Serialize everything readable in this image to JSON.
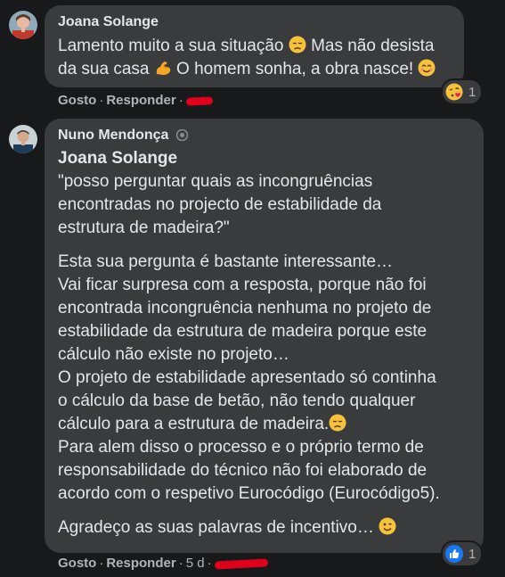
{
  "comment1": {
    "author": "Joana Solange",
    "line1": "Lamento muito a sua situação",
    "line1b": "Mas não desista",
    "line2a": "da sua casa",
    "line2b": "O homem sonha, a obra nasce!",
    "like": "Gosto",
    "reply": "Responder",
    "reaction_count": "1",
    "emojis": [
      "disappointed-face",
      "flexed-biceps",
      "smiling-face",
      "face-blowing-kiss"
    ]
  },
  "comment2": {
    "author": "Nuno Mendonça",
    "mention": "Joana Solange",
    "lines": [
      "\"posso perguntar quais as incongruências",
      "encontradas no projecto de estabilidade da",
      "estrutura de madeira?\""
    ],
    "lines2": [
      "Esta sua pergunta é bastante interessante…",
      "Vai ficar surpresa com a resposta, porque não foi",
      "encontrada incongruência nenhuma no projeto de",
      "estabilidade da estrutura de madeira porque este",
      "cálculo não existe no projeto…",
      "O projeto de estabilidade apresentado só continha",
      "o cálculo da base de betão, não tendo qualquer",
      "cálculo para a estrutura de madeira.",
      "Para alem disso o processo e o próprio termo de",
      "responsabilidade do técnico não foi elaborado de",
      "acordo com o respetivo Eurocódigo (Eurocódigo5)."
    ],
    "closing": "Agradeço as suas palavras de incentivo…",
    "like": "Gosto",
    "reply": "Responder",
    "time": "5 d",
    "reaction_count": "1",
    "emojis": [
      "disappointed-face",
      "winking-face",
      "like-reaction"
    ]
  },
  "colors": {
    "background": "#18191a",
    "bubble": "#3a3b3c",
    "text": "#e4e6eb",
    "secondary": "#b0b3b8",
    "redaction": "#e0001b",
    "like_blue": "#1877f2"
  }
}
